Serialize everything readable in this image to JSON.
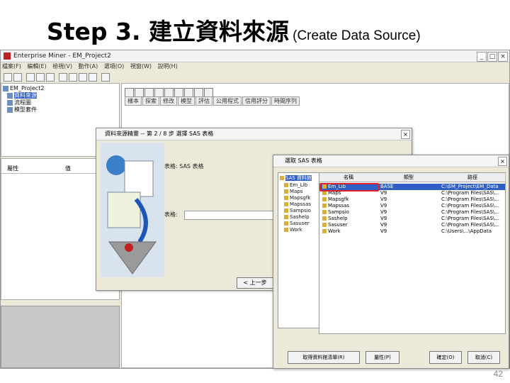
{
  "slide": {
    "title_main": "Step 3. 建立資料來源",
    "title_sub": "(Create Data Source)",
    "page_number": "42"
  },
  "window": {
    "title": "Enterprise Miner - EM_Project2",
    "menu": [
      "檔案(F)",
      "編輯(E)",
      "檢視(V)",
      "動作(A)",
      "選項(O)",
      "視窗(W)",
      "說明(H)"
    ],
    "controls": {
      "minimize": "_",
      "maximize": "□",
      "close": "×"
    }
  },
  "project_tree": {
    "items": [
      {
        "label": "EM_Project2",
        "selected": false
      },
      {
        "label": "資料來源",
        "selected": true
      },
      {
        "label": "流程圖",
        "selected": false
      },
      {
        "label": "模型套件",
        "selected": false
      }
    ]
  },
  "properties": {
    "col_property": "屬性",
    "col_value": "值"
  },
  "diagram_tabs": [
    "樣本",
    "探索",
    "修改",
    "模型",
    "評估",
    "公用程式",
    "信用評分",
    "時間序列"
  ],
  "wizard": {
    "title": "資料來源精靈 -- 第 2 / 8 步 選擇 SAS 表格",
    "field_table": "表格: SAS 表格",
    "field_name": "表格:",
    "back_button": "< 上一步"
  },
  "chooser": {
    "title": "選取 SAS 表格",
    "library_root": "SAS 資料館",
    "libraries": [
      {
        "name": "Em_Lib",
        "selected": false
      },
      {
        "name": "Maps",
        "selected": false
      },
      {
        "name": "Mapsgfk",
        "selected": false
      },
      {
        "name": "Mapssas",
        "selected": false
      },
      {
        "name": "Sampsio",
        "selected": false
      },
      {
        "name": "Sashelp",
        "selected": false
      },
      {
        "name": "Sasuser",
        "selected": false
      },
      {
        "name": "Work",
        "selected": false
      }
    ],
    "columns": [
      "名稱",
      "類型",
      "路徑"
    ],
    "rows": [
      {
        "name": "Em_Lib",
        "type": "BASE",
        "path": "C:\\EM_Project\\EM_Data",
        "selected": true
      },
      {
        "name": "Maps",
        "type": "V9",
        "path": "C:\\Program Files\\SAS\\...",
        "selected": false
      },
      {
        "name": "Mapsgfk",
        "type": "V9",
        "path": "C:\\Program Files\\SAS\\...",
        "selected": false
      },
      {
        "name": "Mapssas",
        "type": "V9",
        "path": "C:\\Program Files\\SAS\\...",
        "selected": false
      },
      {
        "name": "Sampsio",
        "type": "V9",
        "path": "C:\\Program Files\\SAS\\...",
        "selected": false
      },
      {
        "name": "Sashelp",
        "type": "V9",
        "path": "C:\\Program Files\\SAS\\...",
        "selected": false
      },
      {
        "name": "Sasuser",
        "type": "V9",
        "path": "C:\\Program Files\\SAS\\...",
        "selected": false
      },
      {
        "name": "Work",
        "type": "V9",
        "path": "C:\\Users\\...\\AppData",
        "selected": false
      }
    ],
    "buttons": {
      "refresh": "取得資料館清單(R)",
      "properties": "屬性(P)",
      "ok": "確定(O)",
      "cancel": "取消(C)"
    }
  }
}
